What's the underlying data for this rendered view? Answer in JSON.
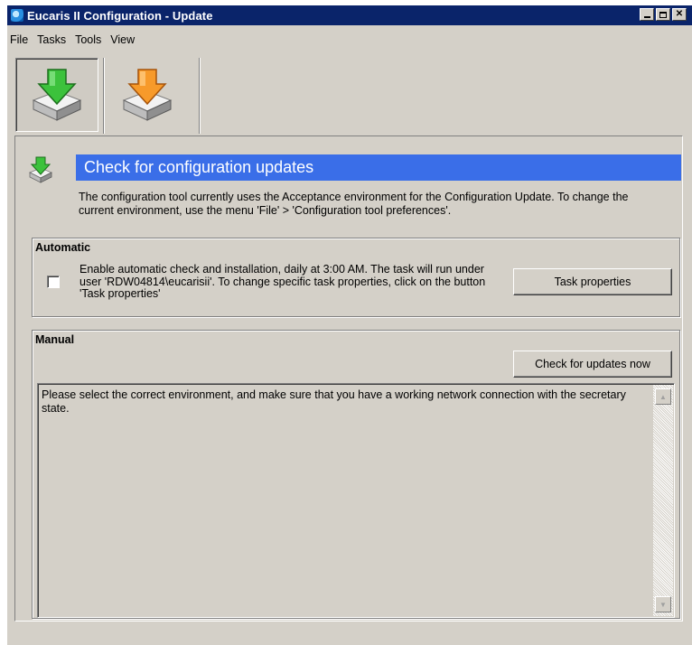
{
  "window": {
    "title": "Eucaris II Configuration - Update",
    "controls": [
      "minimize-icon",
      "maximize-icon",
      "close-icon"
    ]
  },
  "menu": {
    "items": [
      "File",
      "Tasks",
      "Tools",
      "View"
    ]
  },
  "toolbar": {
    "buttons": [
      {
        "icon": "download-green-arrow-icon",
        "active": true
      },
      {
        "icon": "download-orange-arrow-icon",
        "active": false
      }
    ]
  },
  "header": {
    "icon": "download-green-arrow-icon",
    "title": "Check for configuration updates",
    "accent_color": "#3a6ee8"
  },
  "description": "The configuration tool currently uses the Acceptance environment for the Configuration Update. To change the current environment, use the menu 'File' > 'Configuration tool preferences'.",
  "automatic": {
    "title": "Automatic",
    "checked": false,
    "text": "Enable automatic check and installation, daily at 3:00 AM. The task will run under user 'RDW04814\\eucarisii'. To change specific task properties, click on the button 'Task properties'",
    "button_label": "Task properties"
  },
  "manual": {
    "title": "Manual",
    "button_label": "Check for updates now",
    "log_text": "Please select the correct environment, and make sure that you have a working network connection with the secretary state."
  }
}
